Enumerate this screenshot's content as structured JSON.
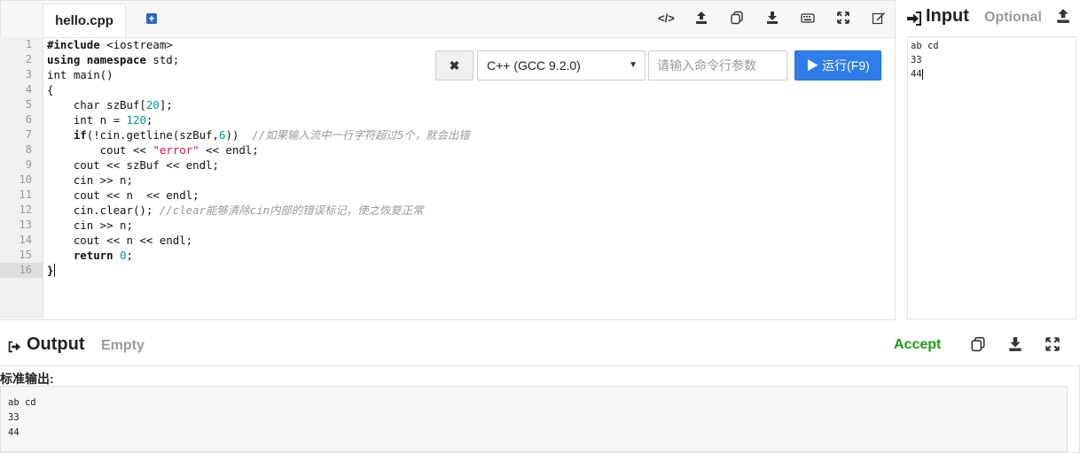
{
  "editor": {
    "tab": "hello.cpp",
    "line_numbers": [
      "1",
      "2",
      "3",
      "4",
      "5",
      "6",
      "7",
      "8",
      "9",
      "10",
      "11",
      "12",
      "13",
      "14",
      "15",
      "16"
    ],
    "active_line": "16",
    "toolbar": [
      "code-icon",
      "upload-icon",
      "copy-icon",
      "download-icon",
      "keyboard-icon",
      "fullscreen-icon",
      "edit-icon"
    ],
    "code": {
      "l1a": "#include",
      "l1b": " <iostream>",
      "l2a": "using namespace",
      "l2b": " std;",
      "l3": "int main()",
      "l4": "{",
      "l5a": "    char szBuf[",
      "l5n": "20",
      "l5b": "];",
      "l6a": "    int n = ",
      "l6n": "120",
      "l6b": ";",
      "l7a": "    if",
      "l7b": "(!cin.getline(szBuf,",
      "l7n": "6",
      "l7c": "))  ",
      "l7cm": "//如果输入流中一行字符超过5个，就会出错",
      "l8a": "        cout << ",
      "l8s": "\"error\"",
      "l8b": " << endl;",
      "l9": "    cout << szBuf << endl;",
      "l10": "    cin >> n;",
      "l11": "    cout << n  << endl;",
      "l12a": "    cin.clear(); ",
      "l12cm": "//clear能够清除cin内部的错误标记，使之恢复正常",
      "l13": "    cin >> n;",
      "l14": "    cout << n << endl;",
      "l15a": "    return",
      "l15n": " 0",
      "l15b": ";",
      "l16": "}"
    }
  },
  "runbar": {
    "stop_label": "✖",
    "language": "C++ (GCC 9.2.0)",
    "args_placeholder": "请输入命令行参数",
    "run_label": "▶ 运行(F9)"
  },
  "input": {
    "title": "Input",
    "subtitle": "Optional",
    "lines": [
      "ab cd",
      "33",
      "44"
    ]
  },
  "output": {
    "title": "Output",
    "subtitle": "Empty",
    "status": "Accept",
    "stdout_label": "标准输出:",
    "lines": [
      "ab cd",
      "33",
      "44"
    ]
  },
  "colors": {
    "accent": "#2e7de8",
    "accept": "#1a9e1a"
  }
}
